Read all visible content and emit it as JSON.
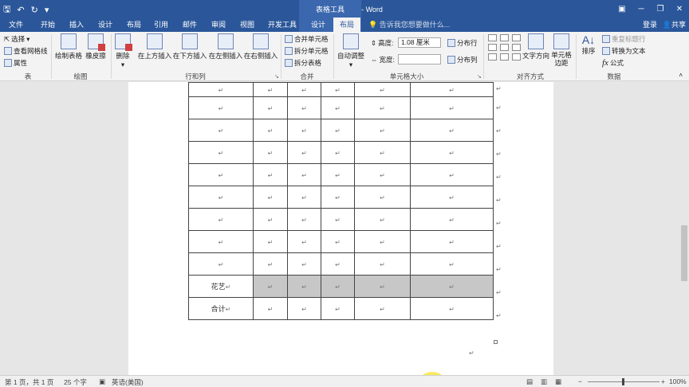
{
  "title_bar": {
    "doc_title": "文档1 [兼容模式] - Word",
    "context_group": "表格工具",
    "qat": {
      "save_icon": "save-icon",
      "undo_icon": "undo-icon",
      "redo_icon": "redo-icon",
      "customize_icon": "customize-qat-icon"
    },
    "window_controls": [
      "ribbon-display-options-icon",
      "minimize-icon",
      "restore-icon",
      "close-icon"
    ]
  },
  "tabs": {
    "file": "文件",
    "home": "开始",
    "insert": "插入",
    "design": "设计",
    "layout": "布局",
    "references": "引用",
    "mailings": "邮件",
    "review": "审阅",
    "view": "视图",
    "developer": "开发工具",
    "table_design": "设计",
    "table_layout": "布局",
    "tell_me": "告诉我您想要做什么...",
    "login": "登录",
    "share": "共享"
  },
  "ribbon": {
    "table_group": {
      "select": "选择",
      "view_gridlines": "查看网格线",
      "properties": "属性",
      "label": "表"
    },
    "draw_group": {
      "draw_table": "绘制表格",
      "eraser": "橡皮擦",
      "label": "绘图"
    },
    "rows_cols_group": {
      "delete": "删除",
      "insert_above": "在上方插入",
      "insert_below": "在下方插入",
      "insert_left": "在左侧插入",
      "insert_right": "在右侧插入",
      "label": "行和列"
    },
    "merge_group": {
      "merge_cells": "合并单元格",
      "split_cells": "拆分单元格",
      "split_table": "拆分表格",
      "label": "合并"
    },
    "cell_size_group": {
      "autofit": "自动调整",
      "height_label": "高度:",
      "height_value": "1.08 厘米",
      "width_label": "宽度:",
      "width_value": "",
      "distribute_rows": "分布行",
      "distribute_cols": "分布列",
      "label": "单元格大小"
    },
    "alignment_group": {
      "text_direction": "文字方向",
      "cell_margins": "单元格边距",
      "label": "对齐方式"
    },
    "data_group": {
      "sort": "排序",
      "repeat_header": "重复标题行",
      "convert_to_text": "转换为文本",
      "formula": "公式",
      "label": "数据"
    }
  },
  "document": {
    "cell_mark": "↵",
    "row_labels": [
      "",
      "",
      "",
      "",
      "",
      "",
      "",
      "",
      "",
      "花艺",
      "合计"
    ],
    "selected_row_index": 9
  },
  "status_bar": {
    "page": "第 1 页，共 1 页",
    "words": "25 个字",
    "language": "英语(美国)",
    "zoom": "100%",
    "zoom_minus": "−",
    "zoom_plus": "+"
  }
}
